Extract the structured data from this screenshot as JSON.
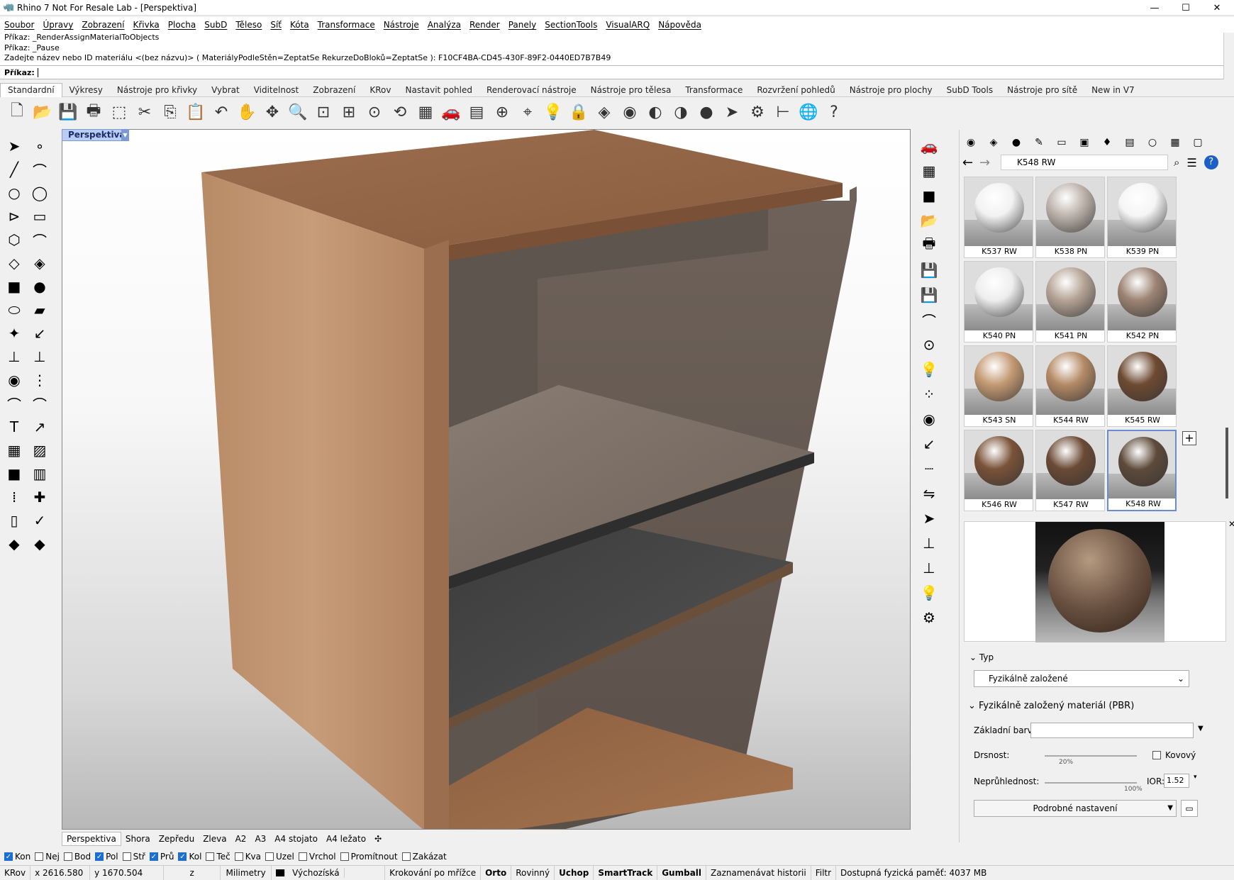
{
  "window": {
    "title": "Rhino 7 Not For Resale Lab - [Perspektiva]"
  },
  "menu": [
    "Soubor",
    "Úpravy",
    "Zobrazení",
    "Křivka",
    "Plocha",
    "SubD",
    "Těleso",
    "Síť",
    "Kóta",
    "Transformace",
    "Nástroje",
    "Analýza",
    "Render",
    "Panely",
    "SectionTools",
    "VisualARQ",
    "Nápověda"
  ],
  "command_history": [
    "Příkaz: _RenderAssignMaterialToObjects",
    "Příkaz: _Pause",
    "Zadejte název nebo ID materiálu <(bez názvu)> ( MateriályPodleStěn=ZeptatSe  RekurzeDoBloků=ZeptatSe ): F10CF4BA-CD45-430F-89F2-0440ED7B7B49"
  ],
  "command_prompt": "Příkaz:",
  "toolbar_tabs": [
    "Standardní",
    "Výkresy",
    "Nástroje pro křivky",
    "Vybrat",
    "Viditelnost",
    "Zobrazení",
    "KRov",
    "Nastavit pohled",
    "Renderovací nástroje",
    "Nástroje pro tělesa",
    "Transformace",
    "Rozvržení pohledů",
    "Nástroje pro plochy",
    "SubD Tools",
    "Nástroje pro sítě",
    "New in V7"
  ],
  "active_toolbar_tab": "Standardní",
  "toolbar_icons": [
    "new-file-icon",
    "open-folder-icon",
    "save-icon",
    "print-icon",
    "import-icon",
    "cut-icon",
    "copy-icon",
    "paste-icon",
    "undo-icon",
    "pan-hand-icon",
    "rotate-view-icon",
    "zoom-icon",
    "zoom-window-icon",
    "zoom-extents-icon",
    "zoom-selected-icon",
    "rotate-camera-icon",
    "four-viewports-icon",
    "car-icon",
    "grid-icon",
    "set-cplane-icon",
    "snap-icon",
    "light-bulb-icon",
    "lock-icon",
    "material-icon",
    "color-wheel-icon",
    "shaded-icon",
    "rendered-icon",
    "sphere-icon",
    "pointer-icon",
    "gear-icon",
    "dimension-icon",
    "globe-icon",
    "help-icon"
  ],
  "viewport": {
    "label": "Perspektiva",
    "tabs": [
      "Perspektiva",
      "Shora",
      "Zepředu",
      "Zleva",
      "A2",
      "A3",
      "A4 stojato",
      "A4 ležato"
    ]
  },
  "panel": {
    "breadcrumb": "K548 RW",
    "materials": [
      {
        "name": "K537 RW",
        "color": "#f2f2f2"
      },
      {
        "name": "K538 PN",
        "color": "#bdb3ab"
      },
      {
        "name": "K539 PN",
        "color": "#f5f5f5"
      },
      {
        "name": "K540 PN",
        "color": "#eeeeee"
      },
      {
        "name": "K541 PN",
        "color": "#b5a496"
      },
      {
        "name": "K542 PN",
        "color": "#9d8474"
      },
      {
        "name": "K543 SN",
        "color": "#c49a73"
      },
      {
        "name": "K544 RW",
        "color": "#b48a66"
      },
      {
        "name": "K545 RW",
        "color": "#6e4a32"
      },
      {
        "name": "K546 RW",
        "color": "#7a5238"
      },
      {
        "name": "K547 RW",
        "color": "#6b4a35"
      },
      {
        "name": "K548 RW",
        "color": "#5e4a3b"
      }
    ],
    "selected": "K548 RW",
    "type_section": "Typ",
    "type_value": "Fyzikálně založené",
    "pbr_section": "Fyzikálně založený materiál (PBR)",
    "base_color_label": "Základní barva:",
    "roughness_label": "Drsnost:",
    "roughness_value": "20%",
    "metallic_label": "Kovový",
    "opacity_label": "Neprůhlednost:",
    "opacity_value": "100%",
    "ior_label": "IOR:",
    "ior_value": "1.52",
    "advanced_button": "Podrobné nastavení"
  },
  "osnaps": [
    {
      "label": "Kon",
      "on": true
    },
    {
      "label": "Nej",
      "on": false
    },
    {
      "label": "Bod",
      "on": false
    },
    {
      "label": "Pol",
      "on": true
    },
    {
      "label": "Stř",
      "on": false
    },
    {
      "label": "Prů",
      "on": true
    },
    {
      "label": "Kol",
      "on": true
    },
    {
      "label": "Teč",
      "on": false
    },
    {
      "label": "Kva",
      "on": false
    },
    {
      "label": "Uzel",
      "on": false
    },
    {
      "label": "Vrchol",
      "on": false
    },
    {
      "label": "Promítnout",
      "on": false
    },
    {
      "label": "Zakázat",
      "on": false
    }
  ],
  "status": {
    "cplane": "KRov",
    "x": "x 2616.580",
    "y": "y 1670.504",
    "z": "z",
    "units": "Milimetry",
    "layer": "Výchozíská",
    "grid_snap": "Krokování po mřížce",
    "ortho": "Orto",
    "planar": "Rovinný",
    "osnap": "Uchop",
    "smarttrack": "SmartTrack",
    "gumball": "Gumball",
    "history": "Zaznamenávat historii",
    "filter": "Filtr",
    "memory": "Dostupná fyzická paměť: 4037 MB"
  }
}
